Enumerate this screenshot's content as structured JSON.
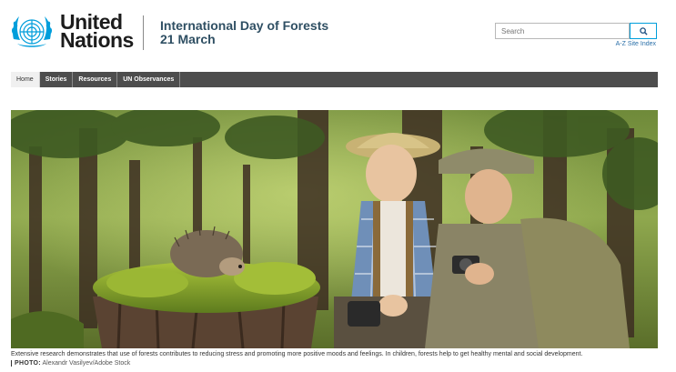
{
  "brand": {
    "line1": "United",
    "line2": "Nations",
    "logo_icon": "un-emblem-icon",
    "logo_color": "#009edb"
  },
  "site": {
    "title_line1": "International Day of Forests",
    "title_line2": "21 March",
    "title_color": "#2f4f63"
  },
  "search": {
    "placeholder": "Search",
    "button_icon": "search-icon",
    "az_label": "A-Z Site Index"
  },
  "nav": {
    "items": [
      {
        "label": "Home",
        "active": true
      },
      {
        "label": "Stories",
        "active": false
      },
      {
        "label": "Resources",
        "active": false
      },
      {
        "label": "UN Observances",
        "active": false
      }
    ],
    "bar_color": "#4d4d4d"
  },
  "hero": {
    "caption": "Extensive research demonstrates that use of forests contributes to reducing stress and promoting more positive moods and feelings. In children, forests help to get healthy mental and social development.",
    "credit_label": "PHOTO:",
    "credit_value": "Alexandr Vasilyev/Adobe Stock"
  }
}
